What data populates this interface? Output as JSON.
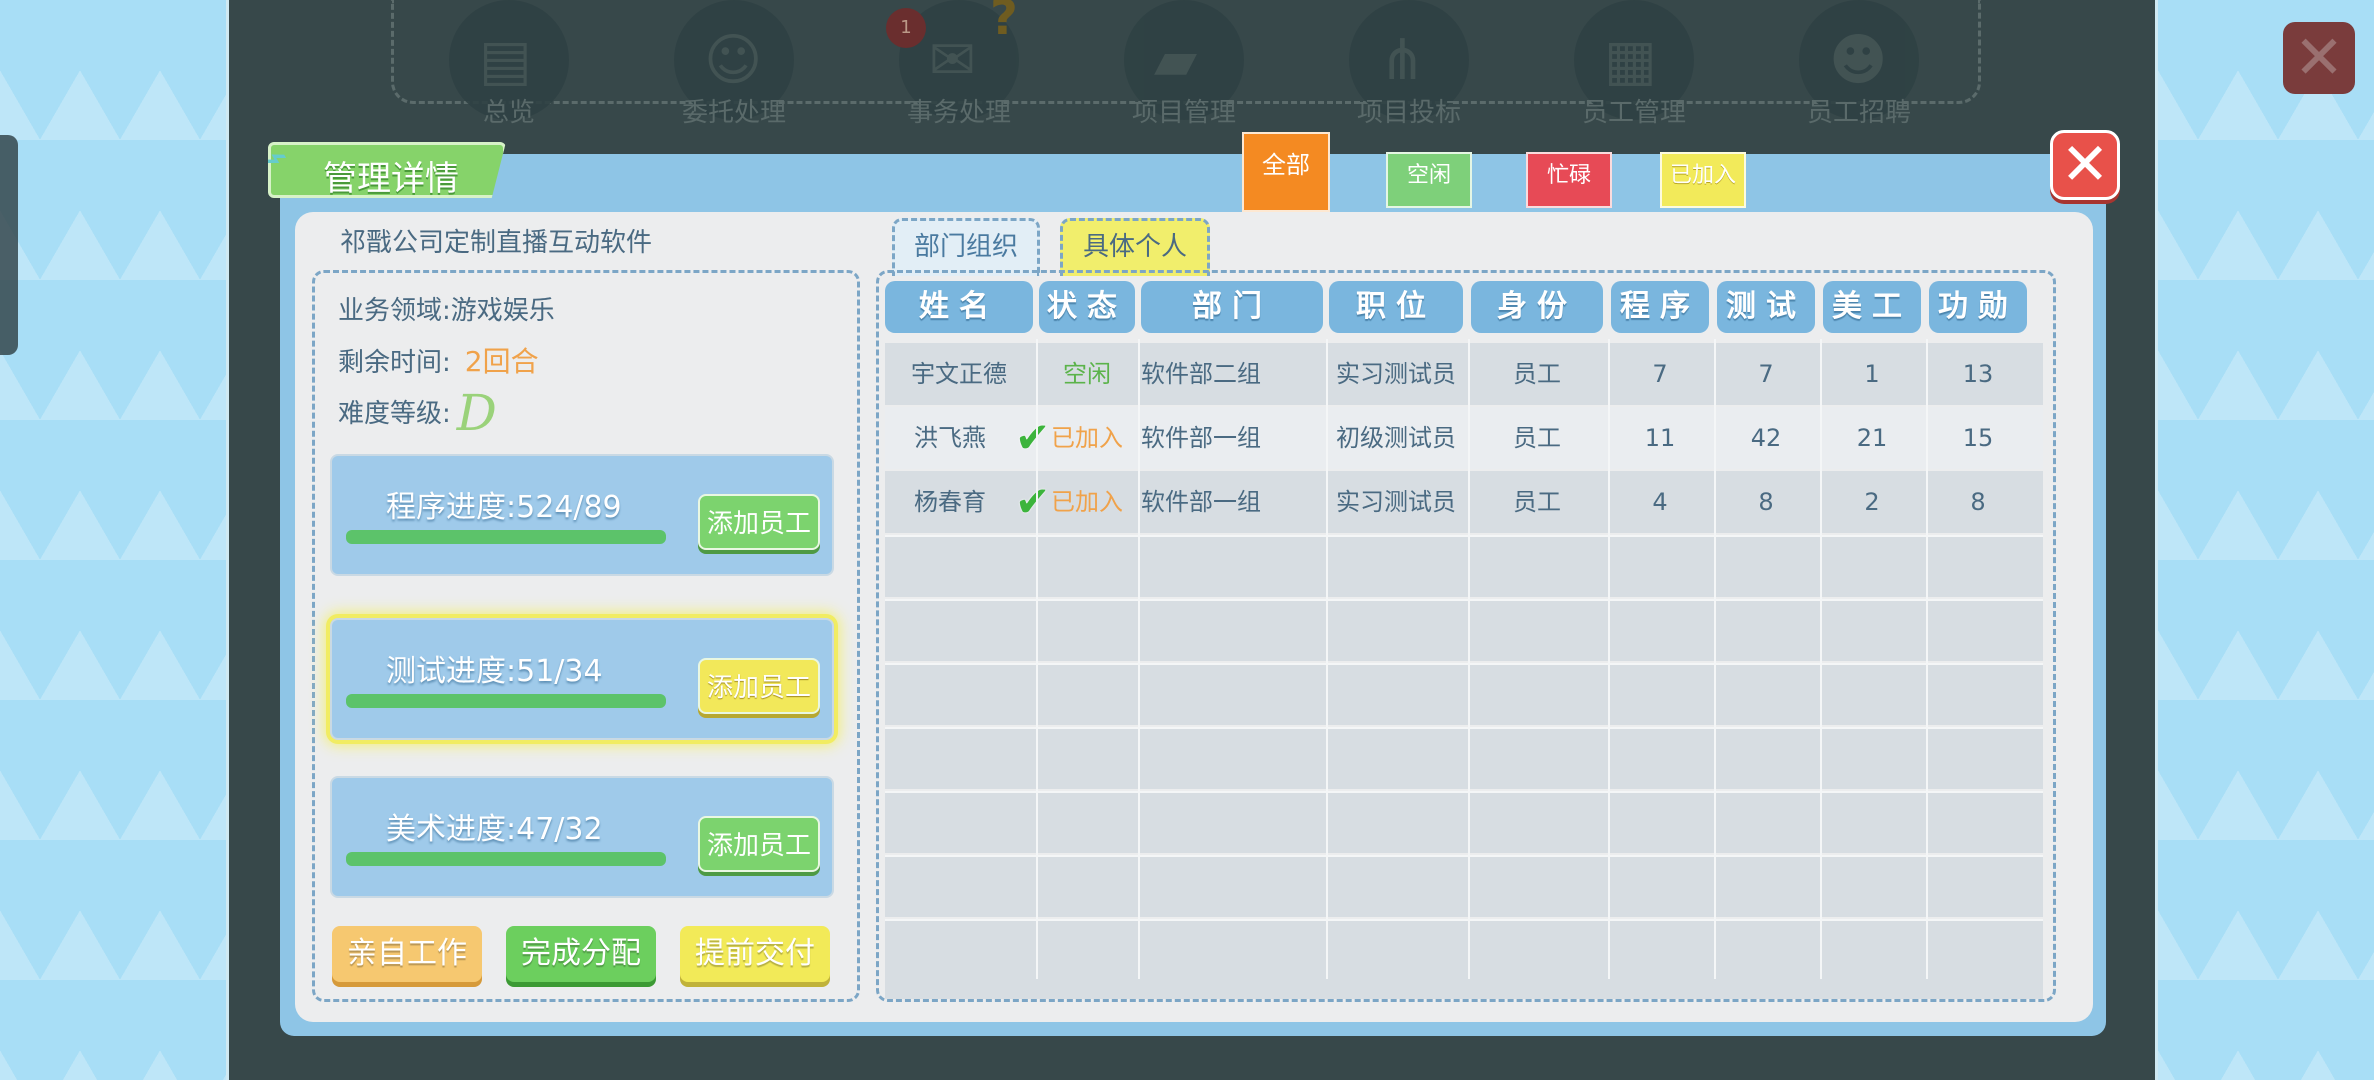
{
  "nav": {
    "items": [
      {
        "label": "总览",
        "icon": "clipboard-icon"
      },
      {
        "label": "委托处理",
        "icon": "agent-icon"
      },
      {
        "label": "事务处理",
        "icon": "chat-icon"
      },
      {
        "label": "项目管理",
        "icon": "folder-icon"
      },
      {
        "label": "项目投标",
        "icon": "share-icon"
      },
      {
        "label": "员工管理",
        "icon": "id-card-icon"
      },
      {
        "label": "员工招聘",
        "icon": "person-icon"
      }
    ],
    "badge": "1",
    "question": "?"
  },
  "panel": {
    "title": "管理详情",
    "close": "✕",
    "project_name": "祁戬公司定制直播互动软件",
    "field_label": "业务领域:",
    "field_value": "游戏娱乐",
    "time_label": "剩余时间:",
    "time_value": "2回合",
    "grade_label": "难度等级:",
    "grade_value": "D"
  },
  "filters": {
    "all": "全部",
    "idle": "空闲",
    "busy": "忙碌",
    "joined": "已加入"
  },
  "progress": [
    {
      "label": "程序进度:524/89",
      "add": "添加员工",
      "fill": 1.0
    },
    {
      "label": "测试进度:51/34",
      "add": "添加员工",
      "fill": 1.0
    },
    {
      "label": "美术进度:47/32",
      "add": "添加员工",
      "fill": 1.0
    }
  ],
  "bottom_buttons": {
    "self_work": "亲自工作",
    "finish": "完成分配",
    "deliver": "提前交付"
  },
  "tabs": {
    "org": "部门组织",
    "individual": "具体个人"
  },
  "table": {
    "headers": [
      "姓名",
      "状态",
      "部门",
      "职位",
      "身份",
      "程序",
      "测试",
      "美工",
      "功勋"
    ],
    "rows": [
      {
        "name": "宇文正德",
        "status": "空闲",
        "dept": "软件部二组",
        "position": "实习测试员",
        "identity": "员工",
        "prog": "7",
        "test": "7",
        "art": "1",
        "merit": "13",
        "checked": false
      },
      {
        "name": "洪飞燕",
        "status": "已加入",
        "dept": "软件部一组",
        "position": "初级测试员",
        "identity": "员工",
        "prog": "11",
        "test": "42",
        "art": "21",
        "merit": "15",
        "checked": true
      },
      {
        "name": "杨春育",
        "status": "已加入",
        "dept": "软件部一组",
        "position": "实习测试员",
        "identity": "员工",
        "prog": "4",
        "test": "8",
        "art": "2",
        "merit": "8",
        "checked": true
      }
    ]
  },
  "colors": {
    "accent_green": "#86d36a",
    "accent_orange": "#f48a22",
    "accent_red": "#e74a56",
    "accent_yellow": "#f2ea5a",
    "panel_blue": "#8ec5e6"
  }
}
